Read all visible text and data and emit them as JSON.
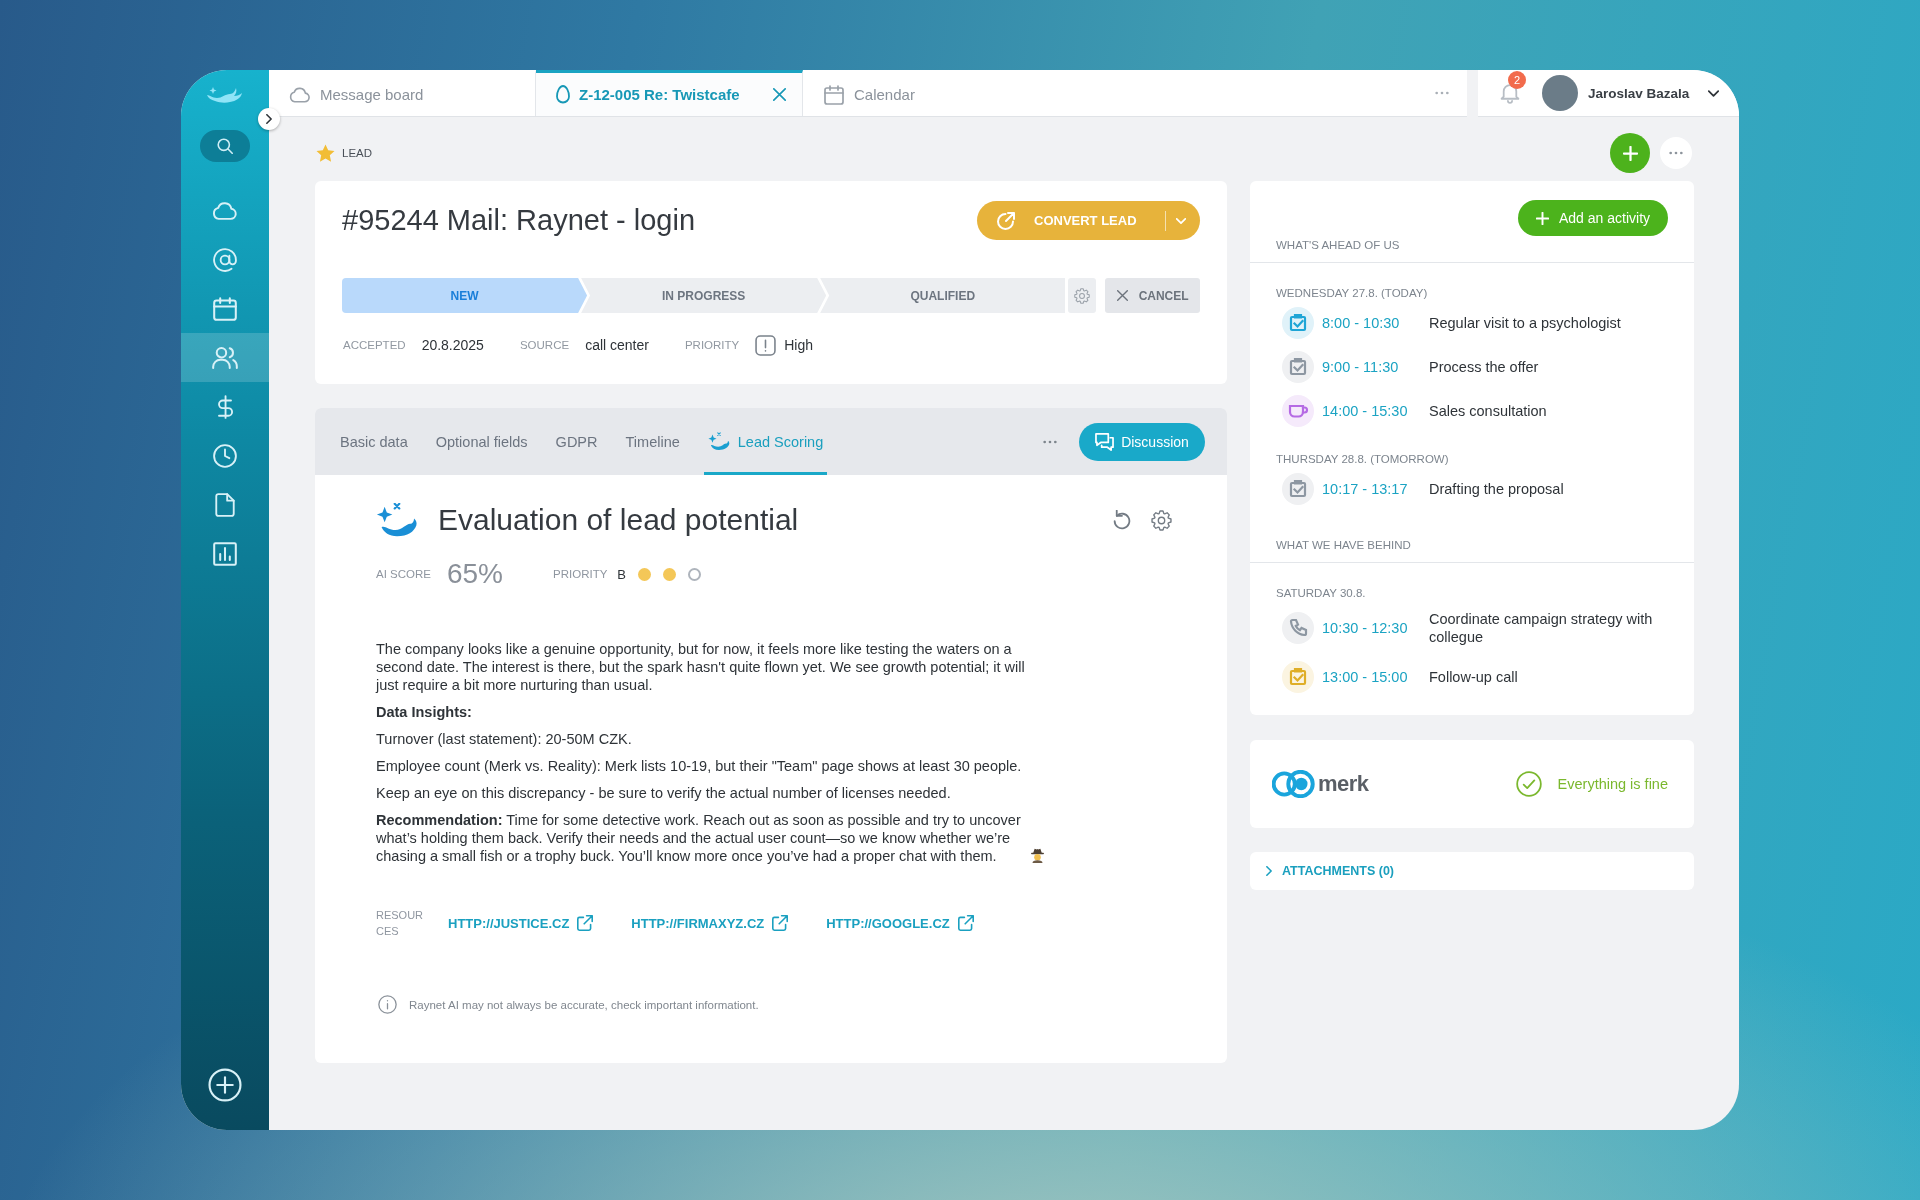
{
  "sidebar": {
    "items": [
      {
        "kind": "cloud",
        "selected": false
      },
      {
        "kind": "at",
        "selected": false
      },
      {
        "kind": "calendar",
        "selected": false
      },
      {
        "kind": "people",
        "selected": true
      },
      {
        "kind": "dollar",
        "selected": false
      },
      {
        "kind": "clock",
        "selected": false
      },
      {
        "kind": "document",
        "selected": false
      },
      {
        "kind": "chart",
        "selected": false
      }
    ]
  },
  "tabs": [
    {
      "kind": "cloud",
      "label": "Message board",
      "selected": false
    },
    {
      "kind": "egg",
      "label": "Z-12-005 Re: Twistcafe",
      "selected": true
    },
    {
      "kind": "calendar",
      "label": "Calendar",
      "selected": false
    }
  ],
  "notifications": {
    "count": "2"
  },
  "user": {
    "name": "Jaroslav Bazala"
  },
  "record_type": "LEAD",
  "lead": {
    "title": "#95244 Mail: Raynet - login",
    "convert_button": "CONVERT LEAD",
    "stages": [
      {
        "label": "NEW",
        "selected": true
      },
      {
        "label": "IN PROGRESS",
        "selected": false
      },
      {
        "label": "QUALIFIED",
        "selected": false
      }
    ],
    "cancel_button": "CANCEL",
    "fields": [
      {
        "kind": "plain",
        "label": "ACCEPTED",
        "value": "20.8.2025"
      },
      {
        "kind": "plain",
        "label": "SOURCE",
        "value": "call center"
      },
      {
        "kind": "priority",
        "label": "PRIORITY",
        "value": "High"
      }
    ]
  },
  "detail_tabs": [
    {
      "kind": "plain",
      "label": "Basic data",
      "selected": false
    },
    {
      "kind": "plain",
      "label": "Optional fields",
      "selected": false
    },
    {
      "kind": "plain",
      "label": "GDPR",
      "selected": false
    },
    {
      "kind": "plain",
      "label": "Timeline",
      "selected": false
    },
    {
      "kind": "whale",
      "label": "Lead Scoring",
      "selected": true
    }
  ],
  "discussion_button": "Discussion",
  "evaluation": {
    "title": "Evaluation of lead potential",
    "ai_score_label": "AI SCORE",
    "ai_score": "65%",
    "priority_label": "PRIORITY",
    "priority_grade": "B",
    "priority_dots": [
      {
        "filled": true
      },
      {
        "filled": true
      },
      {
        "filled": false
      }
    ],
    "paragraphs": [
      {
        "kind": "text",
        "text": "The company looks like a genuine opportunity, but for now, it feels more like testing the waters on a second date. The interest is there, but the spark hasn't quite flown yet. We see growth potential; it will just require a bit more nurturing than usual."
      },
      {
        "kind": "heading",
        "text": "Data Insights:"
      },
      {
        "kind": "text",
        "text": "Turnover (last statement): 20-50M CZK."
      },
      {
        "kind": "text",
        "text": "Employee count (Merk vs. Reality): Merk lists 10-19, but their \"Team\" page shows at least 30 people."
      },
      {
        "kind": "text",
        "text": "Keep an eye on this discrepancy - be sure to verify the actual number of licenses needed."
      },
      {
        "kind": "text_with_emoji",
        "text": "**Recommendation:** Time for some detective work. Reach out as soon as possible and try to uncover what’s holding them back. Verify their needs and the actual user count—so we know whether we’re chasing a small fish or a trophy buck. You’ll know more once you’ve had a proper chat with them."
      }
    ],
    "resources_label": "RESOURCES",
    "resources": [
      "HTTP://JUSTICE.CZ",
      "HTTP://FIRMAXYZ.CZ",
      "HTTP://GOOGLE.CZ"
    ],
    "disclaimer": "Raynet AI may not always be accurate, check important informationt."
  },
  "activities": {
    "add_button": "Add an activity",
    "sections": [
      {
        "title": "WHAT'S AHEAD OF US",
        "days": [
          {
            "date": "WEDNESDAY 27.8. (TODAY)",
            "items": [
              {
                "kind": "checkbox",
                "color": "#1ea5d6",
                "time": "8:00 - 10:30",
                "title": "Regular visit to a psychologist"
              },
              {
                "kind": "checkbox",
                "color": "#8d97a2",
                "time": "9:00 - 11:30",
                "title": "Process the offer"
              },
              {
                "kind": "cup",
                "color": "#b56ae4",
                "time": "14:00 - 15:30",
                "title": "Sales consultation"
              }
            ]
          },
          {
            "date": "THURSDAY 28.8. (TOMORROW)",
            "items": [
              {
                "kind": "checkbox",
                "color": "#8d97a2",
                "time": "10:17 - 13:17",
                "title": "Drafting the proposal"
              }
            ]
          }
        ]
      },
      {
        "title": "WHAT WE HAVE BEHIND",
        "days": [
          {
            "date": "SATURDAY 30.8.",
            "items": [
              {
                "kind": "phone",
                "color": "#8d97a2",
                "time": "10:30 - 12:30",
                "title": "Coordinate campaign strategy with collegue"
              },
              {
                "kind": "checkbox",
                "color": "#dfae27",
                "time": "13:00 - 15:00",
                "title": "Follow-up call"
              }
            ]
          }
        ]
      }
    ]
  },
  "merk": {
    "logo": "merk",
    "status": "Everything is fine"
  },
  "attachments": {
    "label": "ATTACHMENTS (0)",
    "expanded": false
  }
}
